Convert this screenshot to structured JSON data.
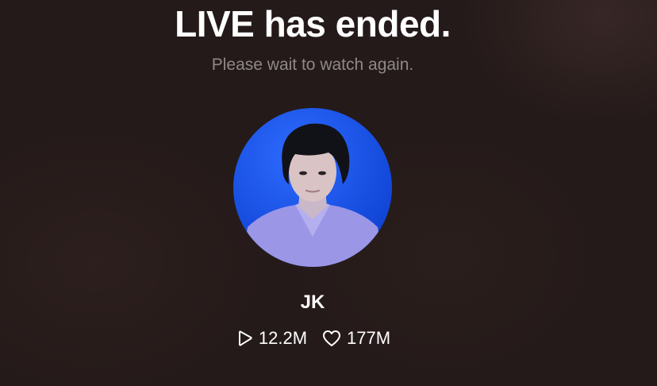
{
  "live_status": {
    "title": "LIVE has ended.",
    "subtitle": "Please wait to watch again."
  },
  "broadcaster": {
    "name": "JK",
    "avatar_background": "#1a56f0"
  },
  "stats": {
    "plays": "12.2M",
    "plays_icon": "play-outline-icon",
    "likes": "177M",
    "likes_icon": "heart-outline-icon"
  }
}
